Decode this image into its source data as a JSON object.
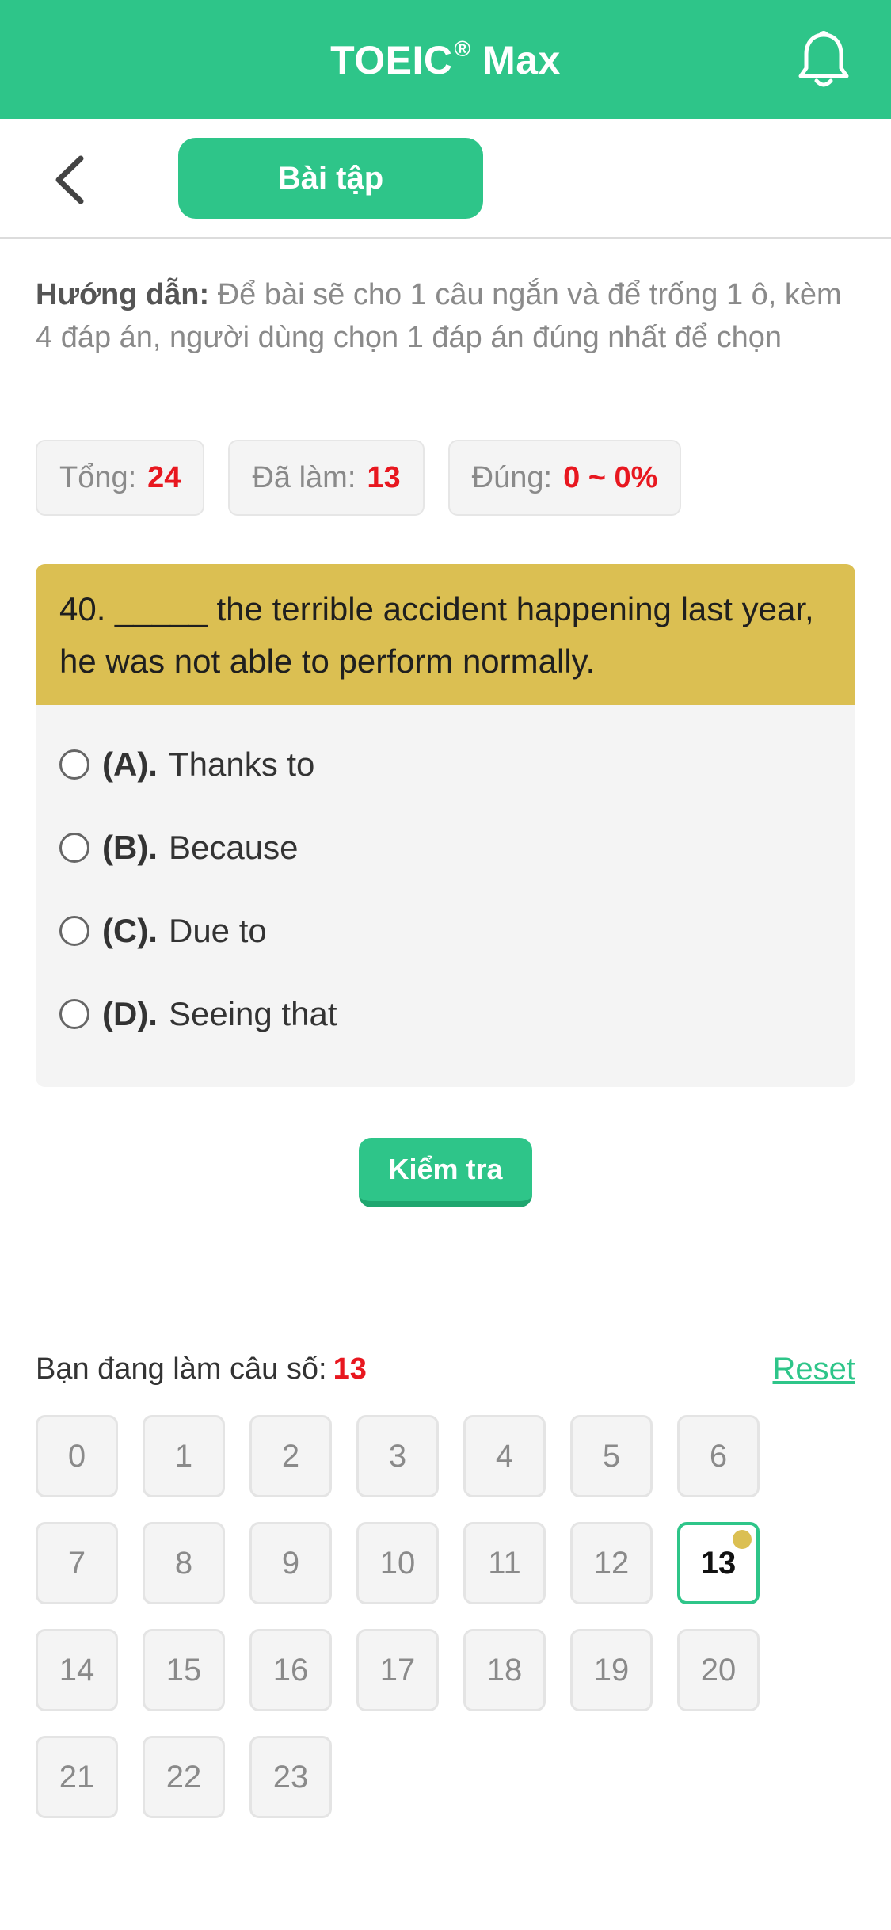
{
  "header": {
    "title": "TOEIC",
    "registered": "®",
    "title_suffix": "Max"
  },
  "subbar": {
    "tab_label": "Bài tập"
  },
  "instructions": {
    "label": "Hướng dẫn:",
    "text": "Để bài sẽ cho 1 câu ngắn và để trống 1 ô, kèm 4 đáp án, người dùng chọn 1 đáp án đúng nhất để chọn"
  },
  "stats": {
    "total_label": "Tổng:",
    "total_value": "24",
    "done_label": "Đã làm:",
    "done_value": "13",
    "correct_label": "Đúng:",
    "correct_value": "0 ~ 0%"
  },
  "question": {
    "text": "40. _____ the terrible accident happening last year, he was not able to perform normally.",
    "options": [
      {
        "key": "(A).",
        "text": "Thanks to"
      },
      {
        "key": "(B).",
        "text": "Because"
      },
      {
        "key": "(C).",
        "text": "Due to"
      },
      {
        "key": "(D).",
        "text": "Seeing that"
      }
    ]
  },
  "check_button": "Kiểm tra",
  "progress": {
    "label": "Bạn đang làm câu số:",
    "current": "13",
    "reset_label": "Reset"
  },
  "question_numbers": [
    "0",
    "1",
    "2",
    "3",
    "4",
    "5",
    "6",
    "7",
    "8",
    "9",
    "10",
    "11",
    "12",
    "13",
    "14",
    "15",
    "16",
    "17",
    "18",
    "19",
    "20",
    "21",
    "22",
    "23"
  ],
  "colors": {
    "brand": "#2ec589",
    "question_header": "#dbbf52",
    "highlight_red": "#e8171f"
  }
}
